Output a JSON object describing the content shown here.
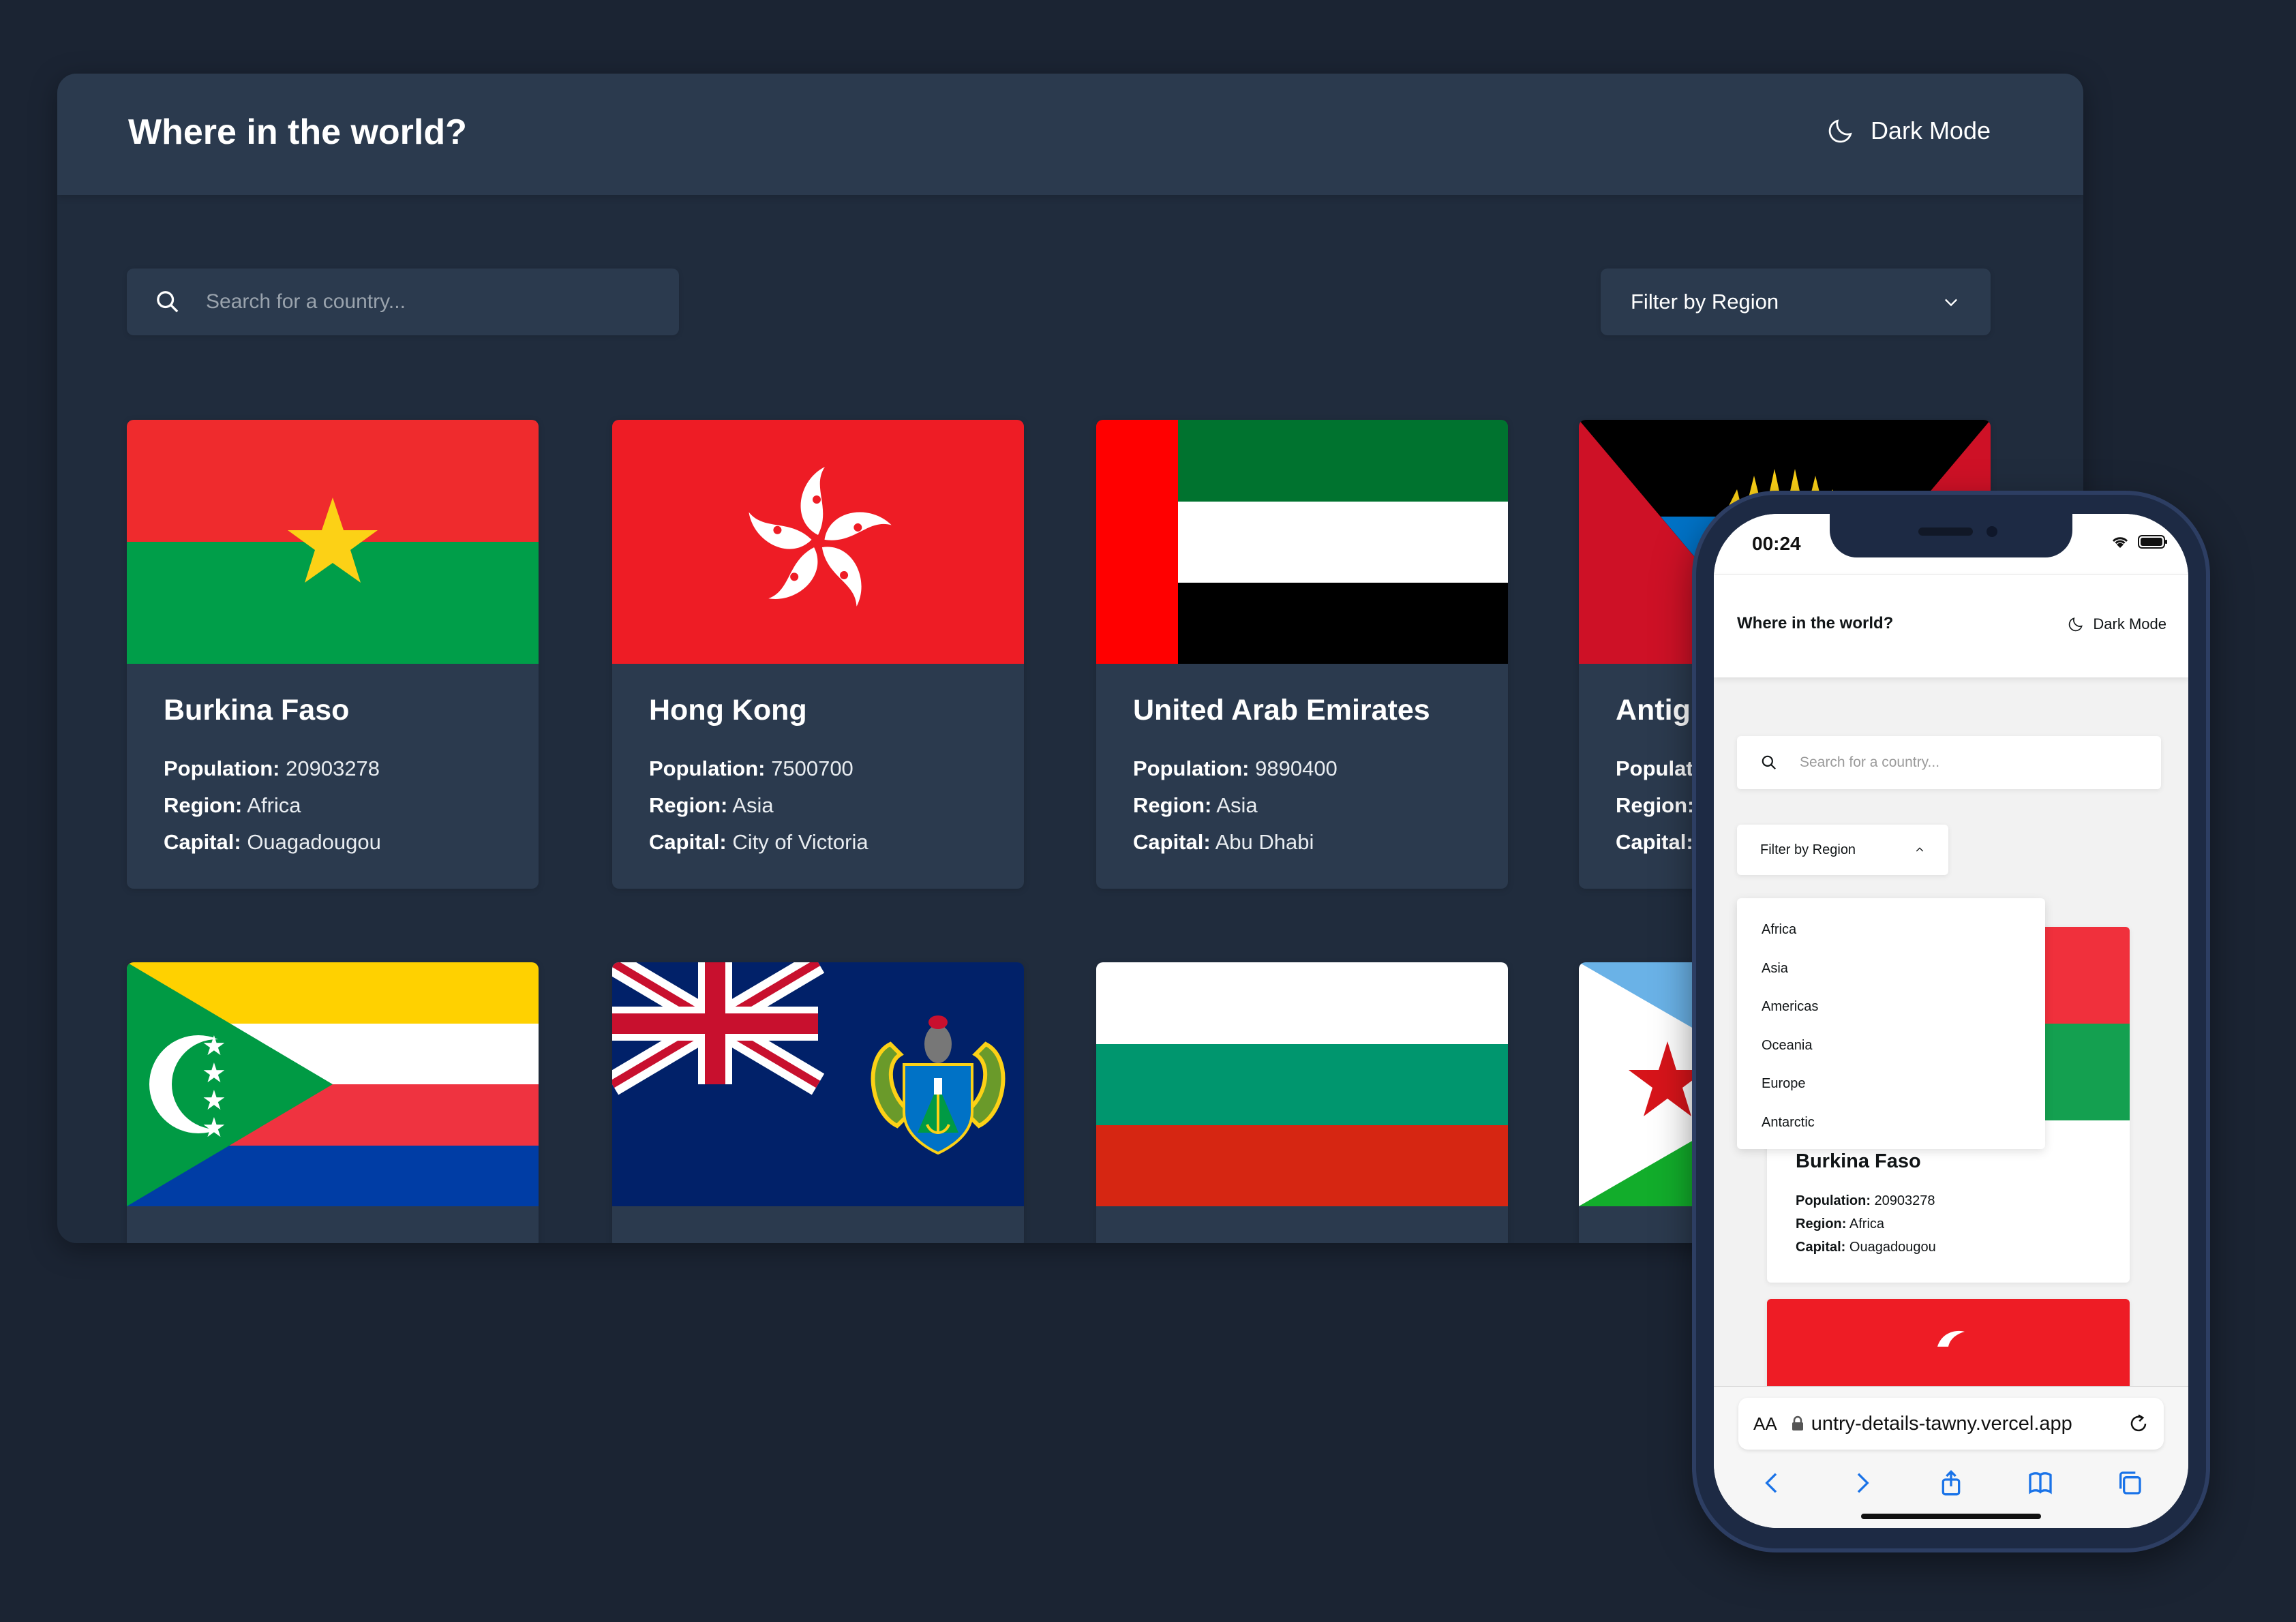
{
  "desktop": {
    "title": "Where in the world?",
    "mode_label": "Dark Mode",
    "search_placeholder": "Search for a country...",
    "filter_label": "Filter by Region",
    "labels": {
      "population": "Population:",
      "region": "Region:",
      "capital": "Capital:"
    },
    "cards": [
      {
        "name": "Burkina Faso",
        "population": "20903278",
        "region": "Africa",
        "capital": "Ouagadougou"
      },
      {
        "name": "Hong Kong",
        "population": "7500700",
        "region": "Asia",
        "capital": "City of Victoria"
      },
      {
        "name": "United Arab Emirates",
        "population": "9890400",
        "region": "Asia",
        "capital": "Abu Dhabi"
      },
      {
        "name": "Antig",
        "population": "",
        "region": "",
        "capital": ""
      }
    ]
  },
  "phone": {
    "time": "00:24",
    "title": "Where in the world?",
    "mode_label": "Dark Mode",
    "search_placeholder": "Search for a country...",
    "filter_label": "Filter by Region",
    "regions": [
      "Africa",
      "Asia",
      "Americas",
      "Oceania",
      "Europe",
      "Antarctic"
    ],
    "card": {
      "name": "Burkina Faso",
      "population": "20903278",
      "region": "Africa",
      "capital": "Ouagadougou"
    },
    "url_prefix": "AA",
    "url": "untry-details-tawny.vercel.app"
  },
  "colors": {
    "background": "#1b2433",
    "dark_element": "#2b3a4e",
    "dark_page": "#202c3d",
    "light_text": "#111517"
  }
}
